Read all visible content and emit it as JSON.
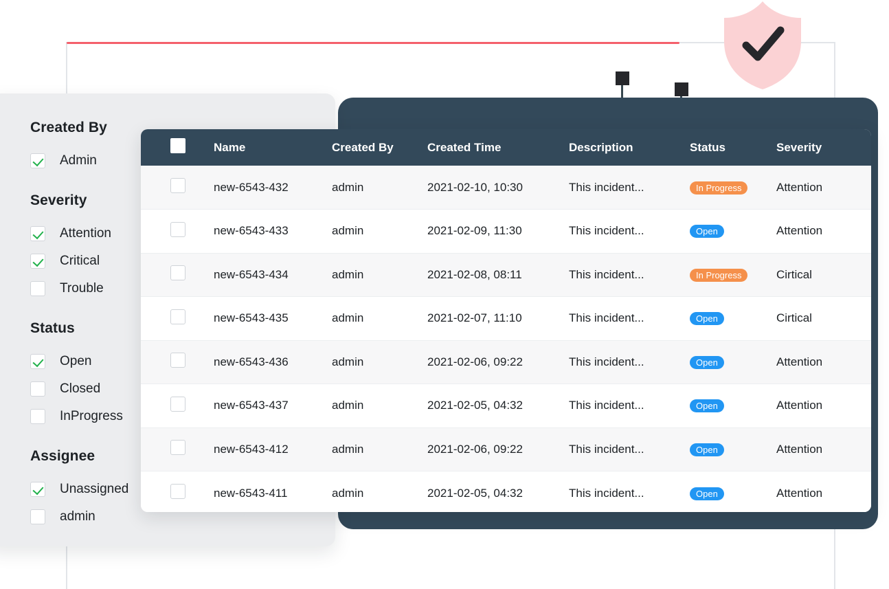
{
  "decor": {
    "accent_line_color": "#f4606c",
    "guide_line_color": "#e2e5e9",
    "frame_color": "#33495a",
    "shield_fill": "#fbd2d4",
    "shield_check_color": "#26272b",
    "shield_icon": "shield-check-icon",
    "server_icon": "server-rack-icon"
  },
  "filters": {
    "groups": [
      {
        "title": "Created By",
        "options": [
          {
            "label": "Admin",
            "checked": true
          }
        ]
      },
      {
        "title": "Severity",
        "options": [
          {
            "label": "Attention",
            "checked": true
          },
          {
            "label": "Critical",
            "checked": true
          },
          {
            "label": "Trouble",
            "checked": false
          }
        ]
      },
      {
        "title": "Status",
        "options": [
          {
            "label": "Open",
            "checked": true
          },
          {
            "label": "Closed",
            "checked": false
          },
          {
            "label": "InProgress",
            "checked": false
          }
        ]
      },
      {
        "title": "Assignee",
        "options": [
          {
            "label": "Unassigned",
            "checked": true
          },
          {
            "label": "admin",
            "checked": false
          }
        ]
      }
    ]
  },
  "table": {
    "select_all_checked": false,
    "columns": [
      {
        "key": "select",
        "label": ""
      },
      {
        "key": "name",
        "label": "Name"
      },
      {
        "key": "created_by",
        "label": "Created By"
      },
      {
        "key": "created_time",
        "label": "Created Time"
      },
      {
        "key": "description",
        "label": "Description"
      },
      {
        "key": "status",
        "label": "Status"
      },
      {
        "key": "severity",
        "label": "Severity"
      }
    ],
    "status_colors": {
      "Open": "#2196f3",
      "In Progress": "#f5904b"
    },
    "rows": [
      {
        "selected": false,
        "name": "new-6543-432",
        "created_by": "admin",
        "created_time": "2021-02-10, 10:30",
        "description": "This incident...",
        "status": "In Progress",
        "severity": "Attention"
      },
      {
        "selected": false,
        "name": "new-6543-433",
        "created_by": "admin",
        "created_time": "2021-02-09, 11:30",
        "description": "This incident...",
        "status": "Open",
        "severity": "Attention"
      },
      {
        "selected": false,
        "name": "new-6543-434",
        "created_by": "admin",
        "created_time": "2021-02-08, 08:11",
        "description": "This incident...",
        "status": "In Progress",
        "severity": "Cirtical"
      },
      {
        "selected": false,
        "name": "new-6543-435",
        "created_by": "admin",
        "created_time": "2021-02-07, 11:10",
        "description": "This incident...",
        "status": "Open",
        "severity": "Cirtical"
      },
      {
        "selected": false,
        "name": "new-6543-436",
        "created_by": "admin",
        "created_time": "2021-02-06, 09:22",
        "description": "This incident...",
        "status": "Open",
        "severity": "Attention"
      },
      {
        "selected": false,
        "name": "new-6543-437",
        "created_by": "admin",
        "created_time": "2021-02-05, 04:32",
        "description": "This incident...",
        "status": "Open",
        "severity": "Attention"
      },
      {
        "selected": false,
        "name": "new-6543-412",
        "created_by": "admin",
        "created_time": "2021-02-06, 09:22",
        "description": "This incident...",
        "status": "Open",
        "severity": "Attention"
      },
      {
        "selected": false,
        "name": "new-6543-411",
        "created_by": "admin",
        "created_time": "2021-02-05, 04:32",
        "description": "This incident...",
        "status": "Open",
        "severity": "Attention"
      }
    ]
  }
}
